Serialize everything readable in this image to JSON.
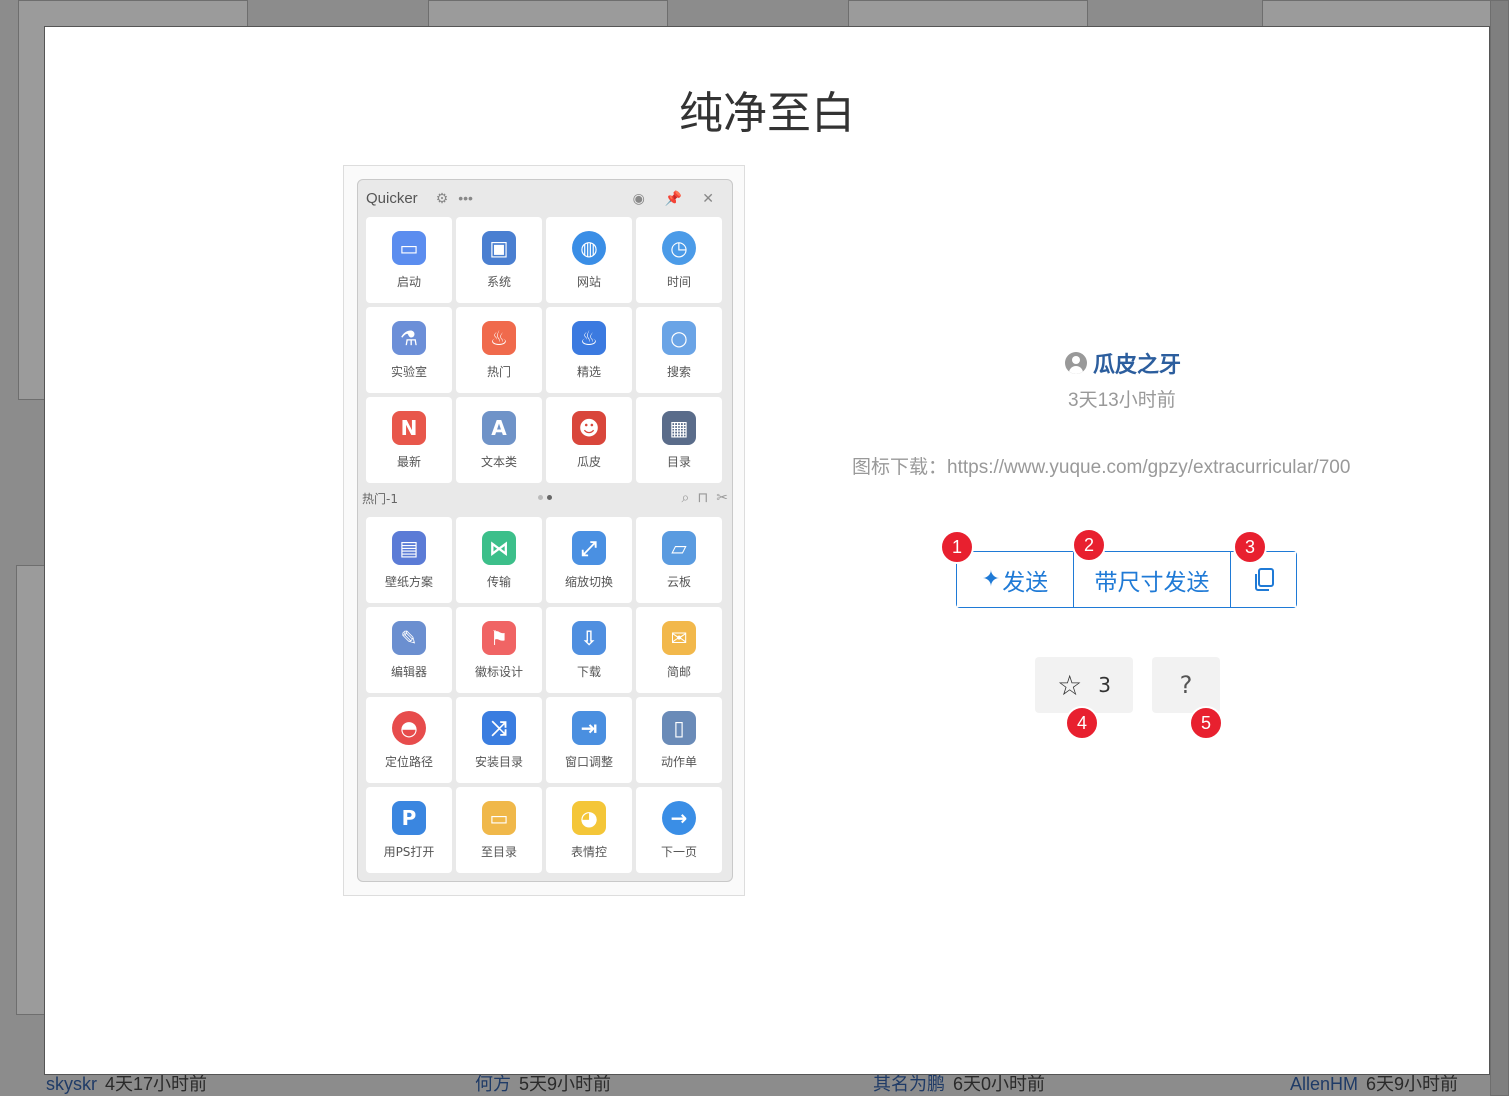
{
  "background": {
    "users": [
      {
        "name": "skyskr",
        "time": "4天17小时前"
      },
      {
        "name": "何方",
        "time": "5天9小时前"
      },
      {
        "name": "其名为鹏",
        "time": "6天0小时前"
      },
      {
        "name": "AllenHM",
        "time": "6天9小时前"
      }
    ]
  },
  "modal": {
    "title": "纯净至白",
    "preview": {
      "app_name": "Quicker",
      "page_label": "热门-1",
      "top_items": [
        {
          "label": "启动",
          "icon": "monitor-plant-icon",
          "color": "#5b8def"
        },
        {
          "label": "系统",
          "icon": "computer-icon",
          "color": "#4a7fd1"
        },
        {
          "label": "网站",
          "icon": "globe-pin-icon",
          "color": "#3a8ee6"
        },
        {
          "label": "时间",
          "icon": "clock-icon",
          "color": "#4b9be8"
        },
        {
          "label": "实验室",
          "icon": "flask-icon",
          "color": "#6c8fd8"
        },
        {
          "label": "热门",
          "icon": "fire-icon",
          "color": "#f06a4c"
        },
        {
          "label": "精选",
          "icon": "blue-fire-icon",
          "color": "#3b7ae0"
        },
        {
          "label": "搜索",
          "icon": "magnifier-icon",
          "color": "#6aa4e6"
        },
        {
          "label": "最新",
          "icon": "new-sign-icon",
          "color": "#e8574b"
        },
        {
          "label": "文本类",
          "icon": "letter-a-icon",
          "color": "#6f93c8"
        },
        {
          "label": "瓜皮",
          "icon": "mario-icon",
          "color": "#d9463b"
        },
        {
          "label": "目录",
          "icon": "grid-icon",
          "color": "#5a6c8a"
        }
      ],
      "bottom_items": [
        {
          "label": "壁纸方案",
          "icon": "layout-icon",
          "color": "#5b7bd6"
        },
        {
          "label": "传输",
          "icon": "bowtie-icon",
          "color": "#3cbf8a"
        },
        {
          "label": "缩放切换",
          "icon": "resize-icon",
          "color": "#4a90e2"
        },
        {
          "label": "云板",
          "icon": "presenter-icon",
          "color": "#5a9be0"
        },
        {
          "label": "编辑器",
          "icon": "notepad-icon",
          "color": "#6b8fd0"
        },
        {
          "label": "徽标设计",
          "icon": "flag-icon",
          "color": "#f06464"
        },
        {
          "label": "下载",
          "icon": "download-icon",
          "color": "#4f8fe0"
        },
        {
          "label": "简邮",
          "icon": "mail-icon",
          "color": "#f2b84b"
        },
        {
          "label": "定位路径",
          "icon": "pokeball-icon",
          "color": "#e74c4c"
        },
        {
          "label": "安装目录",
          "icon": "shuffle-icon",
          "color": "#3a7de0"
        },
        {
          "label": "窗口调整",
          "icon": "window-arrow-icon",
          "color": "#4a8fe0"
        },
        {
          "label": "动作单",
          "icon": "scroll-icon",
          "color": "#6a8bb8"
        },
        {
          "label": "用PS打开",
          "icon": "letter-p-icon",
          "color": "#3a86e0"
        },
        {
          "label": "至目录",
          "icon": "display-icon",
          "color": "#f0b84a"
        },
        {
          "label": "表情控",
          "icon": "pikachu-icon",
          "color": "#f4c638"
        },
        {
          "label": "下一页",
          "icon": "arrow-right-icon",
          "color": "#3a8ee6"
        }
      ]
    },
    "author": {
      "name": "瓜皮之牙",
      "posted": "3天13小时前"
    },
    "description": "图标下载：https://www.yuque.com/gpzy/extracurricular/700",
    "actions": {
      "send": "发送",
      "send_with_size": "带尺寸发送",
      "favorites_count": "3"
    },
    "badges": [
      "1",
      "2",
      "3",
      "4",
      "5"
    ]
  }
}
